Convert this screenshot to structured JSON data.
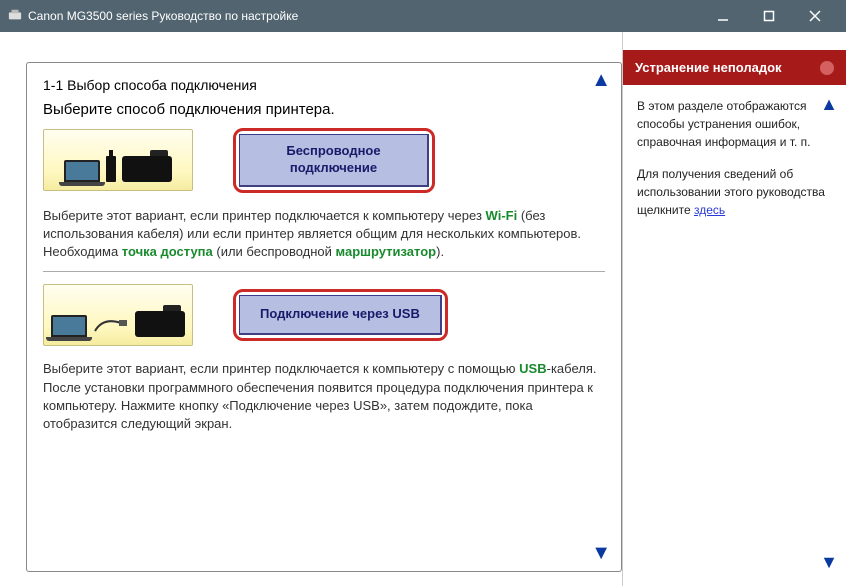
{
  "titlebar": {
    "title": "Canon MG3500 series Руководство по настройке"
  },
  "main": {
    "section_number_title": "1-1 Выбор способа подключения",
    "instruction": "Выберите способ подключения принтера.",
    "option_wireless": {
      "button_line1": "Беспроводное",
      "button_line2": "подключение",
      "desc_prefix": "Выберите этот вариант, если принтер подключается к компьютеру через ",
      "wifi": "Wi-Fi",
      "desc_mid": " (без использования кабеля) или если принтер является общим для нескольких компьютеров. Необходима ",
      "access_point": "точка доступа",
      "desc_mid2": " (или беспроводной ",
      "router": "маршрутизатор",
      "desc_end": ")."
    },
    "option_usb": {
      "button_label": "Подключение через USB",
      "desc_prefix": "Выберите этот вариант, если принтер подключается к компьютеру с помощью ",
      "usb": "USB",
      "desc_rest": "-кабеля. После установки программного обеспечения появится процедура подключения принтера к компьютеру. Нажмите кнопку «Подключение через USB», затем подождите, пока отобразится следующий экран."
    }
  },
  "sidebar": {
    "header": "Устранение неполадок",
    "body1": "В этом разделе отображаются способы устранения ошибок, справочная информация и т. п.",
    "body2_prefix": "Для получения сведений об использовании этого руководства щелкните ",
    "body2_link": "здесь"
  }
}
